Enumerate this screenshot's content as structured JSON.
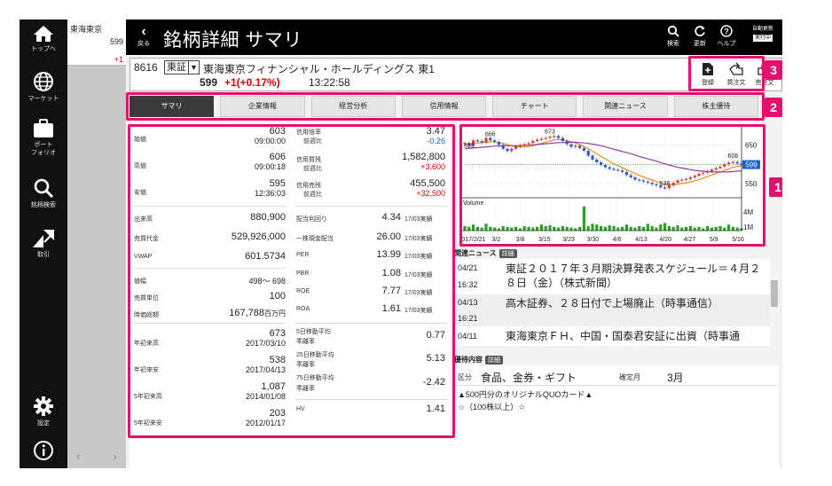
{
  "nav": [
    {
      "label": "トップへ",
      "icon": "home-icon"
    },
    {
      "label": "マーケット",
      "icon": "globe-icon"
    },
    {
      "label": "ポートフォリオ",
      "icon": "briefcase-icon"
    },
    {
      "label": "銘柄検索",
      "icon": "search-icon"
    },
    {
      "label": "取引",
      "icon": "trade-icon"
    },
    {
      "label": "設定",
      "icon": "gear-icon"
    },
    {
      "label": "",
      "icon": "info-icon"
    }
  ],
  "nav_labels": {
    "home": "トップへ",
    "market": "マーケット",
    "portfolio_1": "ポート",
    "portfolio_2": "フォリオ",
    "search": "銘柄検索",
    "trade": "取引",
    "settings": "設定"
  },
  "watchlist": {
    "name": "東海東京",
    "price": "599",
    "change": "+1"
  },
  "header": {
    "back_label": "戻る",
    "title": "銘柄詳細 サマリ",
    "search_label": "検索",
    "refresh_label": "更新",
    "help_label": "ヘルプ",
    "auto_label": "自動更新",
    "auto_state": "実行中"
  },
  "stock": {
    "code": "8616",
    "market": "東証",
    "name": "東海東京フィナンシャル・ホールディングス",
    "section": "東1",
    "price": "599",
    "change": "+1(+0.17%)",
    "time": "13:22:58"
  },
  "order": {
    "register": "登録",
    "buy": "買注文",
    "sell": "売注文"
  },
  "tabs": [
    "サマリ",
    "企業情報",
    "経営分析",
    "信用情報",
    "チャート",
    "関連ニュース",
    "株主優待"
  ],
  "summary": {
    "open": {
      "label": "始値",
      "value": "603",
      "time": "09:00:00"
    },
    "high": {
      "label": "高値",
      "value": "606",
      "time": "09:00:18"
    },
    "low": {
      "label": "安値",
      "value": "595",
      "time": "12:36:03"
    },
    "volume": {
      "label": "出来高",
      "value": "880,900"
    },
    "turnover": {
      "label": "売買代金",
      "value": "529,926,000"
    },
    "vwap": {
      "label": "VWAP",
      "value": "601.5734"
    },
    "price_range": {
      "label": "値幅",
      "value": "498～ 698"
    },
    "unit": {
      "label": "売買単位",
      "value": "100"
    },
    "market_cap": {
      "label": "時価総額",
      "value": "167,788",
      "unit": "百万円"
    },
    "year_high": {
      "label": "年初来高",
      "value": "673",
      "date": "2017/03/10"
    },
    "year_low": {
      "label": "年初来安",
      "value": "538",
      "date": "2017/04/13"
    },
    "high_5y": {
      "label": "5年初来高",
      "value": "1,087",
      "date": "2014/01/08"
    },
    "low_5y": {
      "label": "5年初来安",
      "value": "203",
      "date": "2012/01/17"
    },
    "margin_ratio": {
      "label1": "信用倍率",
      "label2": "前週比",
      "value": "3.47",
      "diff": "-0.26"
    },
    "margin_buy": {
      "label1": "信用買残",
      "label2": "前週比",
      "value": "1,582,800",
      "diff": "+3,600"
    },
    "margin_sell": {
      "label1": "信用売残",
      "label2": "前週比",
      "value": "455,500",
      "diff": "+32,500"
    },
    "dividend_yield": {
      "label": "配当利回り",
      "value": "4.34",
      "note": "17/03実績"
    },
    "dps": {
      "label": "一株現金配当",
      "value": "26.00",
      "note": "17/03実績"
    },
    "per": {
      "label": "PER",
      "value": "13.99",
      "note": "17/03実績"
    },
    "pbr": {
      "label": "PBR",
      "value": "1.08",
      "note": "17/03実績"
    },
    "roe": {
      "label": "ROE",
      "value": "7.77",
      "note": "17/03実績"
    },
    "roa": {
      "label": "ROA",
      "value": "1.61",
      "note": "17/03実績"
    },
    "ma5": {
      "label1": "5日移動平均",
      "label2": "乖離率",
      "value": "0.77"
    },
    "ma25": {
      "label1": "25日移動平均",
      "label2": "乖離率",
      "value": "5.13"
    },
    "ma75": {
      "label1": "75日移動平均",
      "label2": "乖離率",
      "value": "-2.42"
    },
    "hv": {
      "label": "HV",
      "value": "1.41"
    }
  },
  "chart_data": {
    "type": "line",
    "x": [
      "2017/2/21",
      "3/2",
      "3/8",
      "3/15",
      "3/23",
      "3/30",
      "4/6",
      "4/13",
      "4/20",
      "4/27",
      "5/9",
      "5/16"
    ],
    "price_axis_ticks": [
      "650",
      "600",
      "550"
    ],
    "price_annotations": [
      "666",
      "673",
      "639",
      "538",
      "606"
    ],
    "current_price_marker": "599",
    "volume_label": "Volume",
    "volume_axis_ticks": [
      "4M",
      "1M"
    ],
    "series": [
      {
        "values": [
          655,
          648,
          662,
          660,
          656,
          668,
          662,
          658,
          650,
          640,
          634,
          640,
          646,
          650,
          652,
          655,
          660,
          664,
          666,
          668,
          671,
          673,
          668,
          660,
          652,
          645,
          648,
          642,
          635,
          622,
          612,
          605,
          598,
          592,
          588,
          586,
          584,
          580,
          572,
          566,
          560,
          558,
          555,
          552,
          548,
          545,
          540,
          538,
          545,
          552,
          558,
          560,
          562,
          566,
          570,
          575,
          578,
          582,
          586,
          590,
          594,
          600,
          604,
          606,
          602,
          599
        ]
      },
      {
        "values": [
          650,
          652,
          654,
          655,
          656,
          657,
          658,
          658,
          656,
          654,
          651,
          648,
          646,
          645,
          645,
          646,
          648,
          651,
          654,
          657,
          660,
          663,
          664,
          663,
          661,
          658,
          655,
          651,
          646,
          640,
          634,
          627,
          620,
          614,
          607,
          601,
          596,
          591,
          586,
          581,
          576,
          571,
          567,
          563,
          559,
          555,
          551,
          548,
          547,
          547,
          548,
          550,
          552,
          554,
          557,
          560,
          564,
          568,
          572,
          576,
          580,
          584,
          588,
          592,
          594,
          596
        ]
      },
      {
        "values": [
          640,
          641,
          642,
          643,
          644,
          645,
          646,
          647,
          647,
          648,
          648,
          648,
          648,
          648,
          649,
          649,
          650,
          651,
          652,
          653,
          654,
          655,
          656,
          656,
          657,
          657,
          657,
          656,
          655,
          654,
          652,
          650,
          648,
          645,
          642,
          639,
          636,
          633,
          630,
          627,
          624,
          620,
          617,
          614,
          611,
          608,
          604,
          601,
          598,
          595,
          592,
          590,
          588,
          586,
          584,
          583,
          582,
          581,
          580,
          580,
          580,
          580,
          580,
          581,
          582,
          583
        ]
      }
    ],
    "volume": [
      0.6,
      0.5,
      0.8,
      0.5,
      0.4,
      0.9,
      0.5,
      0.4,
      0.3,
      0.6,
      0.5,
      0.4,
      0.5,
      0.3,
      0.6,
      0.5,
      0.4,
      0.5,
      0.8,
      0.6,
      0.7,
      0.5,
      0.4,
      0.6,
      0.5,
      0.4,
      0.3,
      0.5,
      3.2,
      0.6,
      0.9,
      0.8,
      0.6,
      0.5,
      0.7,
      0.6,
      0.4,
      0.5,
      0.8,
      0.5,
      0.4,
      0.6,
      0.5,
      0.9,
      0.6,
      0.4,
      0.8,
      1.0,
      0.6,
      0.5,
      0.7,
      0.4,
      0.5,
      0.6,
      0.4,
      0.5,
      0.3,
      0.6,
      0.4,
      0.5,
      0.6,
      0.4,
      0.8,
      0.5,
      0.4,
      0.3
    ],
    "ylim": [
      520,
      690
    ],
    "volume_max": 4
  },
  "news": {
    "header": "関連ニュース",
    "detail": "詳細",
    "items": [
      {
        "date": "04/21",
        "time": "16:32",
        "title": "東証２０１７年３月期決算発表スケジュール＝４月２８日（金）（株式新聞）"
      },
      {
        "date": "04/13",
        "time": "16:21",
        "title": "高木証券、２８日付で上場廃止（時事通信）"
      },
      {
        "date": "04/11",
        "time": "",
        "title": "東海東京ＦＨ、中国・国泰君安証に出資（時事通"
      }
    ]
  },
  "yutai": {
    "header": "優待内容",
    "detail": "詳細",
    "category_label": "区分",
    "category": "食品、金券・ギフト",
    "month_label": "確定月",
    "month": "3月",
    "desc1": "▲500円分のオリジナルQUOカード▲",
    "desc2": "☆（100株以上）☆"
  },
  "callouts": [
    "1",
    "2",
    "3"
  ]
}
